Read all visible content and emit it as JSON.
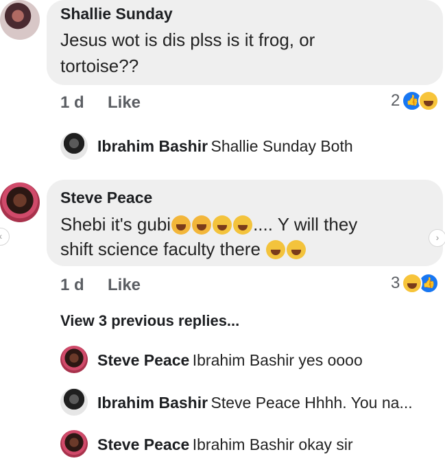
{
  "comments": [
    {
      "author": "Shallie Sunday",
      "text_line1": "Jesus wot is dis plss is it frog, or",
      "text_line2": "tortoise??",
      "time": "1 d",
      "like_label": "Like",
      "reaction_count": "2",
      "avatar_icon": "user-avatar"
    },
    {
      "author": "Steve Peace",
      "text_line1_pre": "Shebi it's gubi",
      "text_line1_post": ".... Y will they",
      "text_line2": "shift science faculty there",
      "time": "1 d",
      "like_label": "Like",
      "reaction_count": "3",
      "avatar_icon": "user-avatar"
    }
  ],
  "replies": [
    {
      "name": "Ibrahim Bashir",
      "text": "Shallie Sunday Both"
    },
    {
      "name": "Steve Peace",
      "text": "Ibrahim Bashir yes oooo"
    },
    {
      "name": "Ibrahim Bashir",
      "text": "Steve Peace Hhhh. You na..."
    },
    {
      "name": "Steve Peace",
      "text": "Ibrahim Bashir okay sir"
    }
  ],
  "view_previous": "View 3 previous replies...",
  "colors": {
    "bubble": "#efefef",
    "like_blue": "#1877f2",
    "emoji_yellow": "#f3c33c"
  },
  "icons": [
    "user-avatar",
    "like-reaction-icon",
    "haha-reaction-icon",
    "crying-emoji-icon",
    "laughing-emoji-icon",
    "chevron-right-icon",
    "chevron-left-icon"
  ]
}
